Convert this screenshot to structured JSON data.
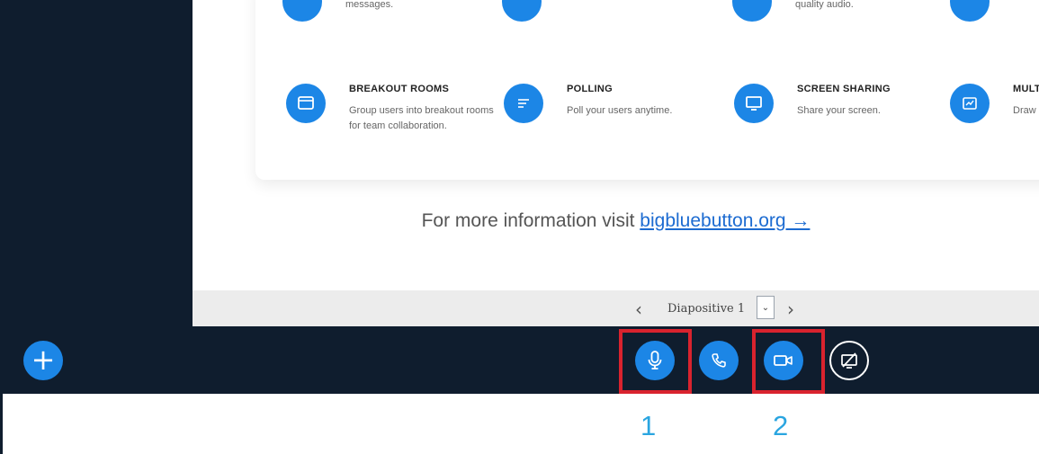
{
  "features": {
    "row1": [
      {
        "title": "",
        "desc": "messages."
      },
      {
        "title": "",
        "desc": ""
      },
      {
        "title": "",
        "desc": "quality audio."
      },
      {
        "title": "",
        "desc": ""
      }
    ],
    "row2": [
      {
        "title": "BREAKOUT ROOMS",
        "desc": "Group users into breakout rooms for team collaboration.",
        "icon": "breakout-rooms-icon"
      },
      {
        "title": "POLLING",
        "desc": "Poll your users anytime.",
        "icon": "polling-icon"
      },
      {
        "title": "SCREEN SHARING",
        "desc": "Share your screen.",
        "icon": "screen-sharing-icon"
      },
      {
        "title": "MULT",
        "desc": "Draw",
        "icon": "whiteboard-icon"
      }
    ]
  },
  "more_info": {
    "prefix": "For more information visit ",
    "link_text": "bigbluebutton.org →"
  },
  "slide_nav": {
    "prev_glyph": "‹",
    "label": "Diapositive 1",
    "select_glyph": "⌄",
    "next_glyph": "›"
  },
  "action_bar": {
    "plus_glyph": "+",
    "buttons": [
      "plus-icon",
      "microphone-icon",
      "phone-icon",
      "video-camera-icon",
      "screen-share-off-icon"
    ]
  },
  "callouts": {
    "first": "1",
    "second": "2"
  },
  "colors": {
    "bar": "#0f1d2e",
    "accent": "#1c86e6",
    "highlight": "#d9232e",
    "callout": "#2aa5e0"
  }
}
